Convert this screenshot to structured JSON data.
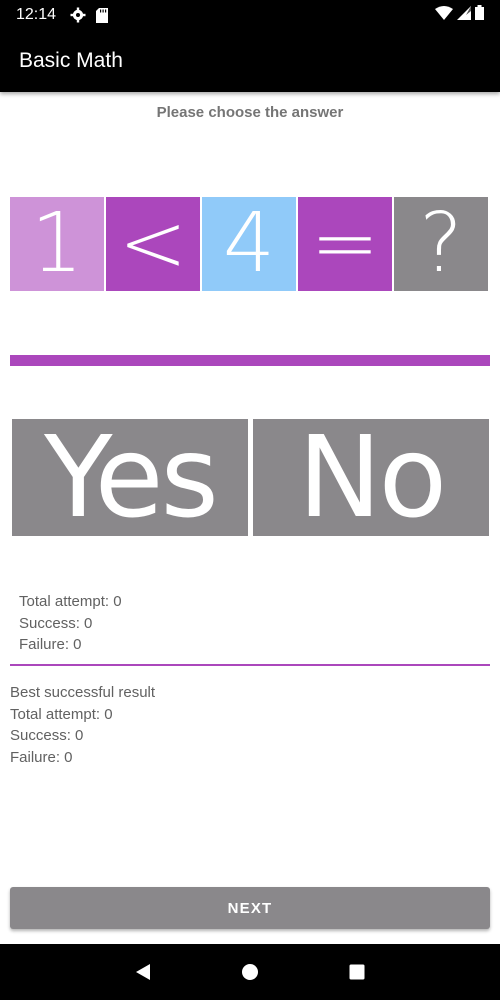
{
  "status_bar": {
    "time": "12:14",
    "icons": [
      "gear-icon",
      "sd-card-icon",
      "wifi-icon",
      "signal-icon",
      "battery-icon"
    ]
  },
  "app_bar": {
    "title": "Basic Math"
  },
  "instruction": "Please choose the answer",
  "equation": [
    {
      "symbol": "1",
      "color": "#ce93d8"
    },
    {
      "symbol": "<",
      "color": "#ab47bc"
    },
    {
      "symbol": "4",
      "color": "#90caf9"
    },
    {
      "symbol": "=",
      "color": "#ab47bc"
    },
    {
      "symbol": "?",
      "color": "#8a888b"
    }
  ],
  "answers": {
    "yes_label": "Yes",
    "no_label": "No"
  },
  "stats": {
    "total_attempt": "Total attempt: 0",
    "success": "Success: 0",
    "failure": "Failure: 0"
  },
  "best": {
    "heading": "Best successful result",
    "total_attempt": "Total attempt: 0",
    "success": "Success: 0",
    "failure": "Failure: 0"
  },
  "next_button": {
    "label": "NEXT"
  },
  "nav_bar": {
    "icons": [
      "back-icon",
      "home-icon",
      "recents-icon"
    ]
  },
  "colors": {
    "accent": "#ab47bc",
    "button_gray": "#8a888b",
    "app_bar": "#000000"
  }
}
